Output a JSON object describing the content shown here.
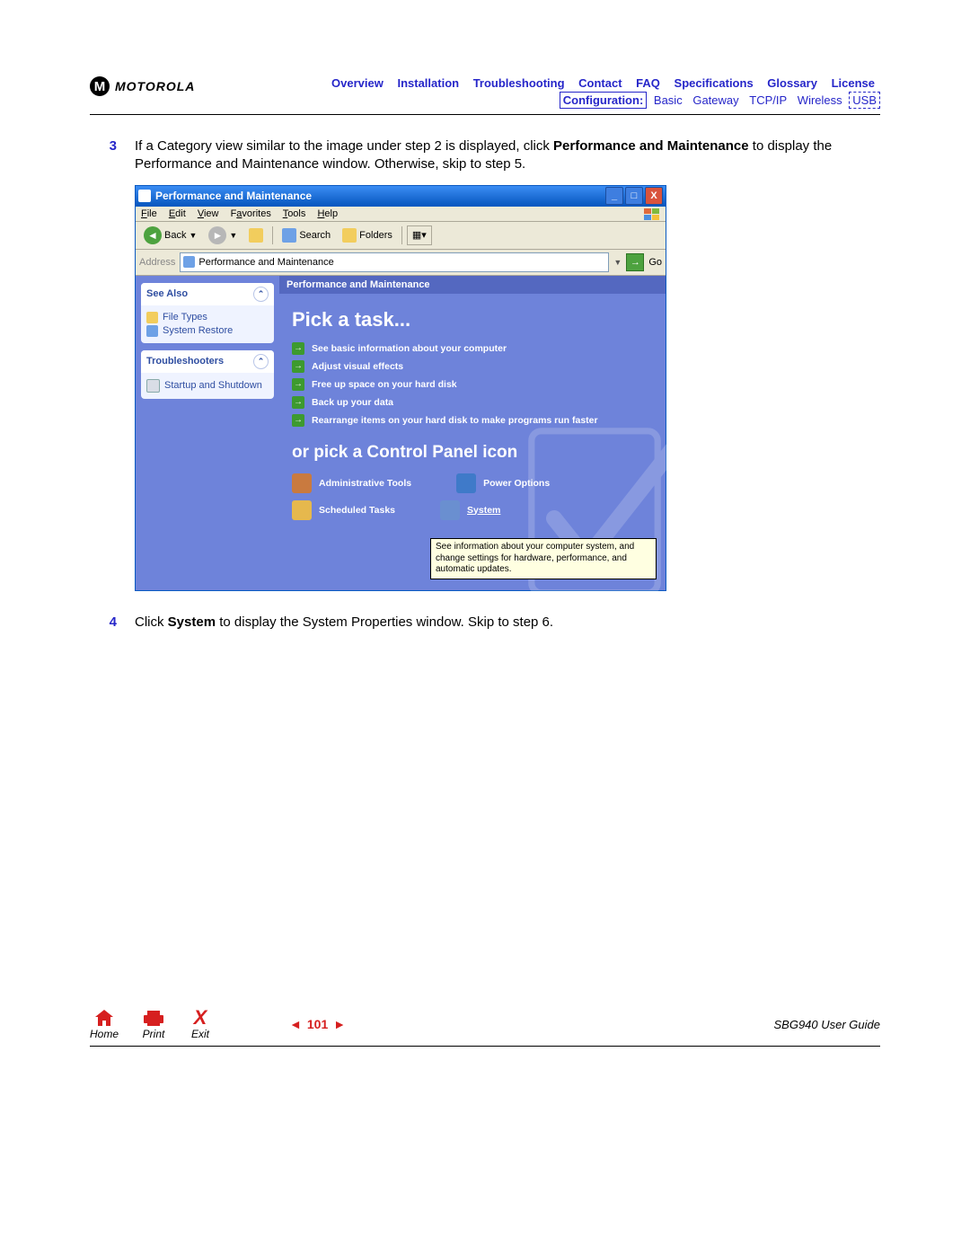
{
  "brand": {
    "logo_letter": "M",
    "name": "MOTOROLA"
  },
  "nav": {
    "top": [
      "Overview",
      "Installation",
      "Troubleshooting",
      "Contact",
      "FAQ",
      "Specifications",
      "Glossary",
      "License"
    ],
    "sub_label": "Configuration:",
    "sub": [
      "Basic",
      "Gateway",
      "TCP/IP",
      "Wireless"
    ],
    "sub_boxed": "USB"
  },
  "steps": {
    "s3_num": "3",
    "s3_pre": "If a Category view similar to the image under step 2 is displayed, click ",
    "s3_bold": "Performance and Maintenance",
    "s3_post": " to display the Performance and Maintenance window. Otherwise, skip to step 5.",
    "s4_num": "4",
    "s4_pre": "Click ",
    "s4_bold": "System",
    "s4_post": " to display the System Properties window. Skip to step 6."
  },
  "xp": {
    "title": "Performance and Maintenance",
    "win_min": "_",
    "win_max": "□",
    "win_close": "X",
    "menu": [
      "File",
      "Edit",
      "View",
      "Favorites",
      "Tools",
      "Help"
    ],
    "tb_back": "Back",
    "tb_search": "Search",
    "tb_folders": "Folders",
    "addr_label": "Address",
    "addr_value": "Performance and Maintenance",
    "addr_go": "Go",
    "side_seealso": "See Also",
    "side_items1": [
      "File Types",
      "System Restore"
    ],
    "side_trouble": "Troubleshooters",
    "side_items2": [
      "Startup and Shutdown"
    ],
    "cat_header": "Performance and Maintenance",
    "h1": "Pick a task...",
    "tasks": [
      "See basic information about your computer",
      "Adjust visual effects",
      "Free up space on your hard disk",
      "Back up your data",
      "Rearrange items on your hard disk to make programs run faster"
    ],
    "h2": "or pick a Control Panel icon",
    "cpl": [
      "Administrative Tools",
      "Power Options",
      "Scheduled Tasks",
      "System"
    ],
    "tooltip": "See information about your computer system, and change settings for hardware, performance, and automatic updates."
  },
  "footer": {
    "home": "Home",
    "print": "Print",
    "exit": "Exit",
    "exit_x": "X",
    "page": "101",
    "guide": "SBG940 User Guide"
  }
}
